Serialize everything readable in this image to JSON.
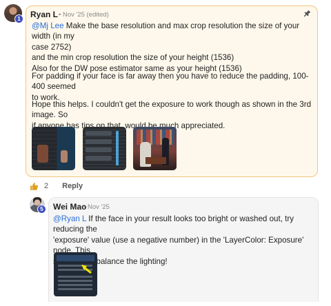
{
  "comment": {
    "author": "Ryan L",
    "level_badge": "1",
    "meta": "• Nov '25 (edited)",
    "mention": "@Mj Lee",
    "line1_rest": " Make the base resolution and max crop resolution the size of your width (in my",
    "line2": "case 2752)",
    "line3": "and the min crop resolution the size of your height (1536)",
    "line4": "Also for the DW pose estimator same as your height (1536)",
    "para2_line1": "For padding if your face is far away then you have to reduce the padding, 100-400 seemed",
    "para2_line2": "to work.",
    "para3_line1": "Hope this helps. I couldn't get the exposure to work though as shown in the 3rd image. So",
    "para3_line2": "if anyone has tips on that, would be much appreciated.",
    "attachments": [
      "workflow-screenshot-1",
      "workflow-screenshot-2",
      "generated-image-3"
    ],
    "likes": "2",
    "reply_label": "Reply",
    "icons": {
      "pin": "pin-icon",
      "like": "thumbs-up-icon"
    }
  },
  "reply": {
    "author": "Wei Mao",
    "level_badge": "5",
    "meta": "• Nov '25",
    "mention": "@Ryan L",
    "line1_rest": " If the face in your result looks too bright or washed out, try reducing the",
    "line2": "'exposure' value (use a negative number) in the 'LayerColor: Exposure' node. This",
    "line3": "should help balance the lighting!",
    "attachments": [
      "node-screenshot"
    ]
  },
  "colors": {
    "highlight_bg": "#fef8ec",
    "highlight_border": "#f2c57c",
    "mention": "#2a6fd6",
    "level_badge": "#3f4fbf",
    "like_icon": "#e0a020"
  }
}
